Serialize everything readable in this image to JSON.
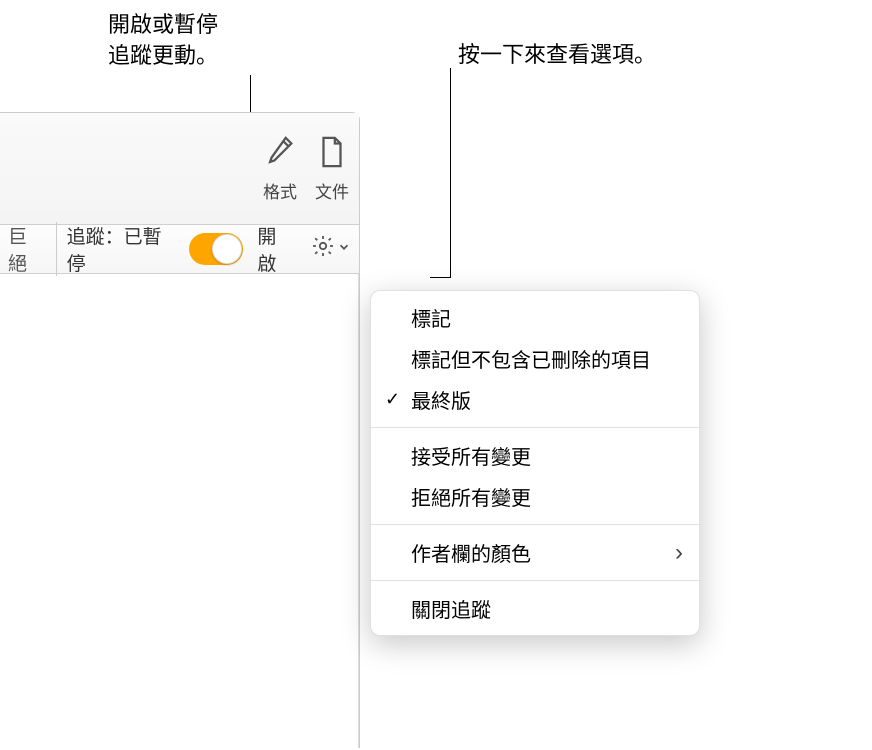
{
  "callouts": {
    "toggle_hint": "開啟或暫停\n追蹤更動。",
    "gear_hint": "按一下來查看選項。"
  },
  "toolbar": {
    "format_label": "格式",
    "document_label": "文件"
  },
  "review_bar": {
    "reject_partial": "巨絕",
    "track_label": "追蹤：已暫停",
    "on_label": "開啟"
  },
  "menu": {
    "markup": "標記",
    "markup_no_delete": "標記但不包含已刪除的項目",
    "final": "最終版",
    "accept_all": "接受所有變更",
    "reject_all": "拒絕所有變更",
    "author_color": "作者欄的顏色",
    "turn_off": "關閉追蹤"
  },
  "menu_state": {
    "checked": "final"
  }
}
